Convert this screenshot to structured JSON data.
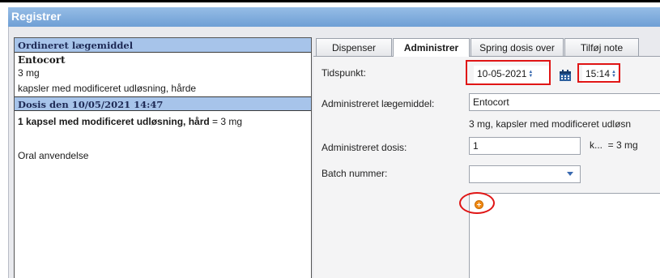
{
  "window": {
    "title": "Registrer"
  },
  "left_panel": {
    "ordered_header": "Ordineret lægemiddel",
    "drug_name": "Entocort",
    "strength": "3 mg",
    "form": "kapsler med modificeret udløsning, hårde",
    "dose_header": "Dosis den 10/05/2021 14:47",
    "dose_bold": "1 kapsel med modificeret udløsning, hård",
    "dose_rest": " = 3 mg",
    "route": "Oral anvendelse"
  },
  "tabs": [
    {
      "label": "Dispenser"
    },
    {
      "label": "Administrer"
    },
    {
      "label": "Spring dosis over"
    },
    {
      "label": "Tilføj note"
    }
  ],
  "form": {
    "time_label": "Tidspunkt:",
    "date_value": "10-05-2021",
    "time_value": "15:14",
    "drug_label": "Administreret lægemiddel:",
    "drug_value": "Entocort",
    "drug_desc": "3 mg, kapsler med modificeret udløsn",
    "dose_label": "Administreret dosis:",
    "dose_value": "1",
    "dose_unit": "k...  = 3 mg",
    "batch_label": "Batch nummer:",
    "batch_value": ""
  },
  "icons": {
    "calendar": "calendar-icon",
    "spinner": "spinner-arrows-icon",
    "add": "add-note-icon",
    "dropdown": "chevron-down-icon"
  },
  "colors": {
    "title_bar": "#7ba7dc",
    "section_header": "#a7c4ea",
    "highlight": "#e01515",
    "add_icon": "#f08a15"
  }
}
